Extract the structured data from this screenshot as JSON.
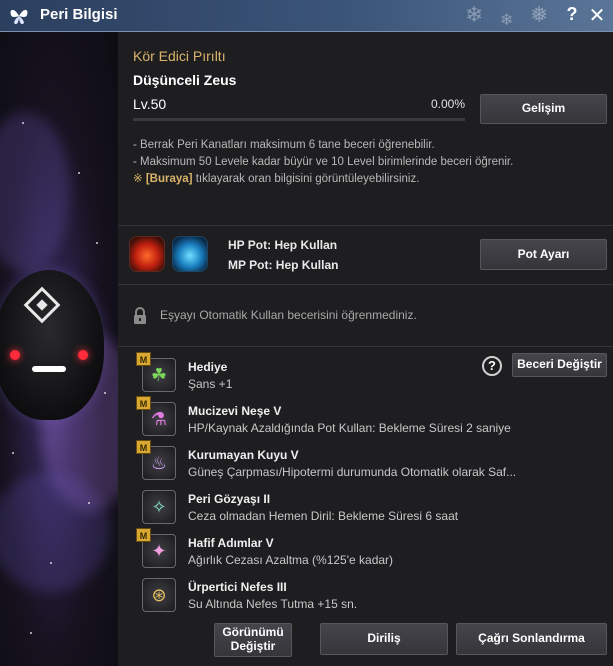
{
  "window": {
    "title": "Peri Bilgisi",
    "help_label": "?",
    "close_label": "✕"
  },
  "fairy": {
    "type": "Kör Edici Pırıltı",
    "name": "Düşünceli Zeus",
    "level_label": "Lv.",
    "level": "50",
    "xp_percent_text": "0.00%",
    "xp_fraction": 0.0,
    "develop_button": "Gelişim"
  },
  "notes": [
    "- Berrak Peri Kanatları maksimum 6 tane beceri öğrenebilir.",
    "- Maksimum 50 Levele kadar büyür ve 10 Level birimlerinde beceri öğrenir."
  ],
  "rate_note": {
    "mark": "※",
    "link": "[Buraya]",
    "text": " tıklayarak oran bilgisini görüntüleyebilirsiniz."
  },
  "potions": {
    "hp_label": "HP Pot: Hep Kullan",
    "mp_label": "MP Pot: Hep Kullan",
    "settings_button": "Pot Ayarı"
  },
  "auto_use": {
    "text": "Eşyayı Otomatik Kullan becerisini öğrenmediniz."
  },
  "skills_header": {
    "change_button": "Beceri Değiştir",
    "help_label": "?"
  },
  "skills": [
    {
      "name": "Hediye",
      "desc": "Şans +1",
      "badge": "M",
      "icon": "clover-icon",
      "glyph": "☘",
      "color": "#7bd65a"
    },
    {
      "name": "Mucizevi Neşe V",
      "desc": "HP/Kaynak Azaldığında Pot Kullan: Bekleme Süresi 2 saniye",
      "badge": "M",
      "icon": "potion-icon",
      "glyph": "⚗",
      "color": "#e07be0"
    },
    {
      "name": "Kurumayan Kuyu V",
      "desc": "Güneş Çarpması/Hipotermi durumunda Otomatik olarak Saf...",
      "badge": "M",
      "icon": "bowl-icon",
      "glyph": "♨",
      "color": "#d8a8ff"
    },
    {
      "name": "Peri Gözyaşı II",
      "desc": "Ceza olmadan Hemen Diril: Bekleme Süresi 6 saat",
      "badge": "",
      "icon": "tear-icon",
      "glyph": "✧",
      "color": "#7fe0c0"
    },
    {
      "name": "Hafif Adımlar V",
      "desc": "Ağırlık Cezası Azaltma (%125'e kadar)",
      "badge": "M",
      "icon": "bag-icon",
      "glyph": "✦",
      "color": "#f0a0e0"
    },
    {
      "name": "Ürpertici Nefes III",
      "desc": "Su Altında Nefes Tutma +15 sn.",
      "badge": "",
      "icon": "breath-icon",
      "glyph": "⊛",
      "color": "#e8c060"
    }
  ],
  "footer": {
    "view_button_line1": "Görünümü",
    "view_button_line2": "Değiştir",
    "revive_button": "Diriliş",
    "dismiss_button": "Çağrı Sonlandırma"
  }
}
